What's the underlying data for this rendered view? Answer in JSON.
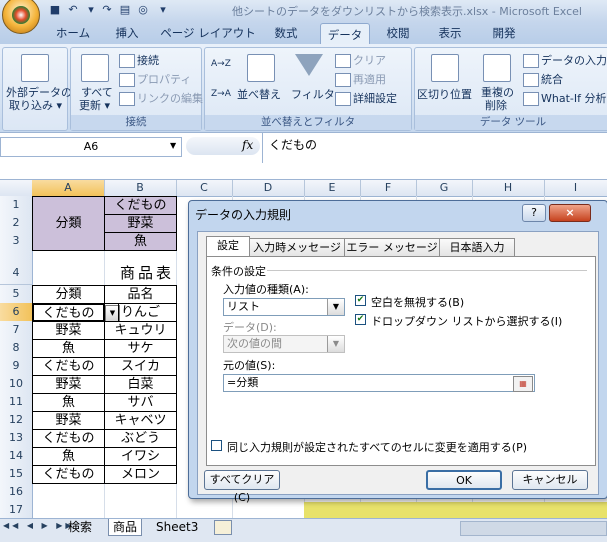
{
  "window": {
    "title": "他シートのデータをダウンリストから検索表示.xlsx - Microsoft Excel"
  },
  "ribbon_tabs": [
    "ホーム",
    "挿入",
    "ページ レイアウト",
    "数式",
    "データ",
    "校閲",
    "表示",
    "開発"
  ],
  "active_tab": "データ",
  "ribbon": {
    "external": {
      "label1": "外部データの",
      "label2": "取り込み ▾"
    },
    "refresh": {
      "label1": "すべて",
      "label2": "更新 ▾"
    },
    "connections": {
      "label": "接続",
      "properties": "プロパティ",
      "edit_links": "リンクの編集",
      "group": "接続"
    },
    "sort": {
      "sort_asc": "A→Z",
      "sort_desc": "Z→A",
      "sort": "並べ替え",
      "filter": "フィルタ",
      "clear": "クリア",
      "reapply": "再適用",
      "advanced": "詳細設定",
      "group": "並べ替えとフィルタ"
    },
    "tools": {
      "text_to_columns": "区切り位置",
      "remove_dup1": "重複の",
      "remove_dup2": "削除",
      "validation": "データの入力規",
      "consolidate": "統合",
      "whatif": "What-If 分析",
      "group": "データ ツール"
    }
  },
  "formula_bar": {
    "name_box": "A6",
    "fx": "fx",
    "formula": "くだもの"
  },
  "columns": [
    "A",
    "B",
    "C",
    "D",
    "E",
    "F",
    "G",
    "H",
    "I"
  ],
  "rows": [
    "1",
    "2",
    "3",
    "4",
    "5",
    "6",
    "7",
    "8",
    "9",
    "10",
    "11",
    "12",
    "13",
    "14",
    "15",
    "16",
    "17"
  ],
  "cells": {
    "a1_3": "分類",
    "b1": "くだもの",
    "b2": "野菜",
    "b3": "魚",
    "b4": "商品表",
    "a5": "分類",
    "b5": "品名",
    "rows": [
      {
        "a": "くだもの",
        "b": "りんご"
      },
      {
        "a": "野菜",
        "b": "キュウリ"
      },
      {
        "a": "魚",
        "b": "サケ"
      },
      {
        "a": "くだもの",
        "b": "スイカ"
      },
      {
        "a": "野菜",
        "b": "白菜"
      },
      {
        "a": "魚",
        "b": "サバ"
      },
      {
        "a": "野菜",
        "b": "キャベツ"
      },
      {
        "a": "くだもの",
        "b": "ぶどう"
      },
      {
        "a": "魚",
        "b": "イワシ"
      },
      {
        "a": "くだもの",
        "b": "メロン"
      }
    ]
  },
  "sheet_tabs": [
    "検索",
    "商品",
    "Sheet3"
  ],
  "active_sheet": "商品",
  "dialog": {
    "title": "データの入力規則",
    "help": "?",
    "close": "×",
    "tabs": [
      "設定",
      "入力時メッセージ",
      "エラー メッセージ",
      "日本語入力"
    ],
    "group_label": "条件の設定",
    "allow_label": "入力値の種類(A):",
    "allow_value": "リスト",
    "data_label": "データ(D):",
    "data_value": "次の値の間",
    "ignore_blank": "空白を無視する(B)",
    "in_cell_dropdown": "ドロップダウン リストから選択する(I)",
    "source_label": "元の値(S):",
    "source_value": "=分類",
    "apply_all": "同じ入力規則が設定されたすべてのセルに変更を適用する(P)",
    "clear_all": "すべてクリア(C)",
    "ok": "OK",
    "cancel": "キャンセル"
  }
}
